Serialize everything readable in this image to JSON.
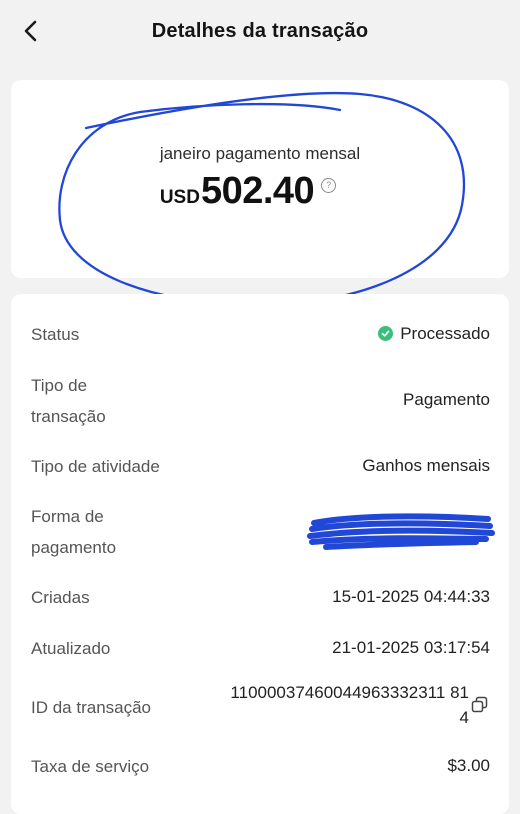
{
  "header": {
    "title": "Detalhes da transação"
  },
  "amount": {
    "description": "janeiro pagamento mensal",
    "currency": "USD",
    "value": "502.40"
  },
  "details": {
    "status": {
      "label": "Status",
      "value": "Processado"
    },
    "transaction_type": {
      "label_line1": "Tipo de",
      "label_line2": "transação",
      "value": "Pagamento"
    },
    "activity_type": {
      "label": "Tipo de atividade",
      "value": "Ganhos mensais"
    },
    "payment_method": {
      "label_line1": "Forma de",
      "label_line2": "pagamento"
    },
    "created": {
      "label": "Criadas",
      "value": "15-01-2025 04:44:33"
    },
    "updated": {
      "label": "Atualizado",
      "value": "21-01-2025 03:17:54"
    },
    "transaction_id": {
      "label": "ID da transação",
      "value_line1": "11000037460044963332311 81",
      "value_line2": "4"
    },
    "service_fee": {
      "label": "Taxa de serviço",
      "value": "$3.00"
    }
  },
  "colors": {
    "page_bg": "#f2f2f2",
    "card_bg": "#ffffff",
    "status_green": "#3dbd7d",
    "annotation_blue": "#2147d6"
  },
  "icons": [
    "chevron-left-icon",
    "help-icon",
    "check-circle-icon",
    "copy-icon"
  ]
}
